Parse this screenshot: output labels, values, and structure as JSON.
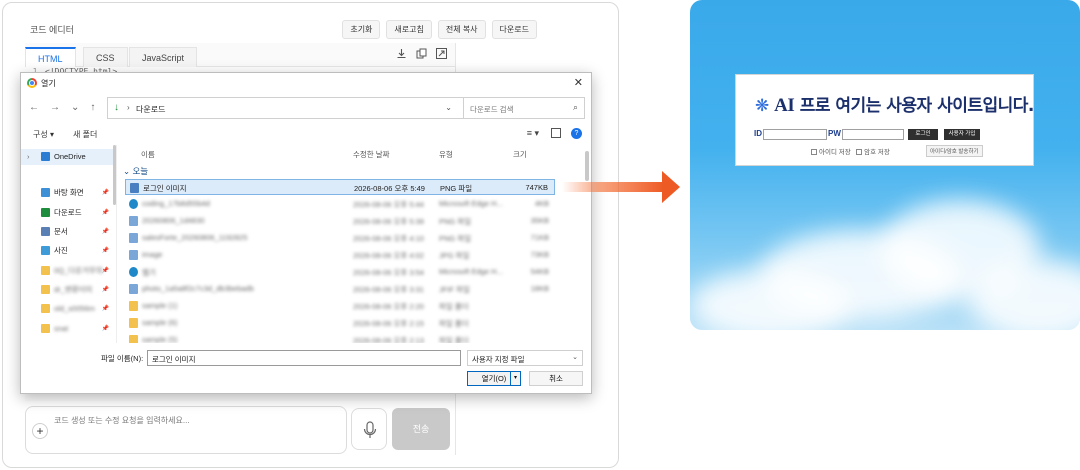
{
  "editor": {
    "title": "코드 에디터",
    "actions": [
      "초기화",
      "새로고침",
      "전체 복사",
      "다운로드"
    ],
    "tabs": [
      "HTML",
      "CSS",
      "JavaScript"
    ],
    "active_tab": "HTML",
    "code_first_line": "<!DOCTYPE html>",
    "prompt_placeholder": "코드 생성 또는 수정 요청을 입력하세요...",
    "send_label": "전송"
  },
  "dialog": {
    "title": "열기",
    "path": "다운로드",
    "search_placeholder": "다운로드 검색",
    "organize": "구성",
    "new_folder": "새 폴더",
    "sidebar": [
      {
        "label": "OneDrive",
        "color": "#2b7cd3",
        "selected": true
      },
      {
        "label": "바탕 화면",
        "color": "#3d8fd6",
        "pinned": true
      },
      {
        "label": "다운로드",
        "color": "#1e8e3e",
        "pinned": true
      },
      {
        "label": "문서",
        "color": "#5a7fb5",
        "pinned": true
      },
      {
        "label": "사진",
        "color": "#3f9ad8",
        "pinned": true
      },
      {
        "label": "0Q_다운거무의",
        "color": "#f2c14e",
        "pinned": true
      },
      {
        "label": "dr_변환이미",
        "color": "#f2c14e",
        "pinned": true
      },
      {
        "label": "old_s0056m",
        "color": "#f2c14e",
        "pinned": true
      },
      {
        "label": "snat",
        "color": "#f2c14e",
        "pinned": true
      }
    ],
    "columns": {
      "name": "이름",
      "date": "수정한 날짜",
      "type": "유형",
      "size": "크기"
    },
    "group_label": "오늘",
    "files": [
      {
        "name": "로그인 이미지",
        "date": "2026-08-06 오후 5:49",
        "type": "PNG 파일",
        "size": "747KB",
        "icon": "png",
        "selected": true
      },
      {
        "name": "coding_17b8d55b4d",
        "date": "2026-08-06 오후 5:44",
        "type": "Microsoft Edge H...",
        "size": "4KB",
        "icon": "edge"
      },
      {
        "name": "20260806_1d4830",
        "date": "2026-08-06 오후 5:39",
        "type": "PNG 파일",
        "size": "35KB",
        "icon": "img"
      },
      {
        "name": "salesForte_20260806_1192825",
        "date": "2026-08-06 오후 4:10",
        "type": "PNG 파일",
        "size": "71KB",
        "icon": "img"
      },
      {
        "name": "image",
        "date": "2026-08-06 오후 4:02",
        "type": "JPG 파일",
        "size": "73KB",
        "icon": "img"
      },
      {
        "name": "웹기",
        "date": "2026-08-06 오후 3:54",
        "type": "Microsoft Edge H...",
        "size": "54KB",
        "icon": "edge"
      },
      {
        "name": "photo_1a5a8f2c7c3d_db3bebadb",
        "date": "2026-08-06 오후 3:31",
        "type": "JFIF 파일",
        "size": "18KB",
        "icon": "img"
      },
      {
        "name": "sample (1)",
        "date": "2026-08-06 오후 2:20",
        "type": "파일 폴더",
        "size": "",
        "icon": "folder"
      },
      {
        "name": "sample (6)",
        "date": "2026-08-06 오후 2:15",
        "type": "파일 폴더",
        "size": "",
        "icon": "folder"
      },
      {
        "name": "sample (5)",
        "date": "2026-08-06 오후 2:13",
        "type": "파일 폴더",
        "size": "",
        "icon": "folder"
      },
      {
        "name": "sample (4)",
        "date": "2026-08-06 오후 2:11",
        "type": "파일 폴더",
        "size": "",
        "icon": "folder"
      }
    ],
    "filename_label": "파일 이름(N):",
    "filename_value": "로그인 이미지",
    "filter": "사용자 지정 파일",
    "open_label": "열기(O)",
    "cancel_label": "취소"
  },
  "preview": {
    "brand_ai": "AI",
    "brand_rest": "프로 여기는 사용자 사이트입니다.",
    "id_label": "ID",
    "pw_label": "PW",
    "login_btn": "로그인",
    "signup_btn": "사용자 가입",
    "save_id": "아이디 저장",
    "auto_save": "암호 저장",
    "find_btn": "아이디/암호 발송하기"
  },
  "colors": {
    "accent": "#1a73e8",
    "arrow": "#ee5a24",
    "brand": "#1b2f6b",
    "sky": "#43b1ee"
  }
}
